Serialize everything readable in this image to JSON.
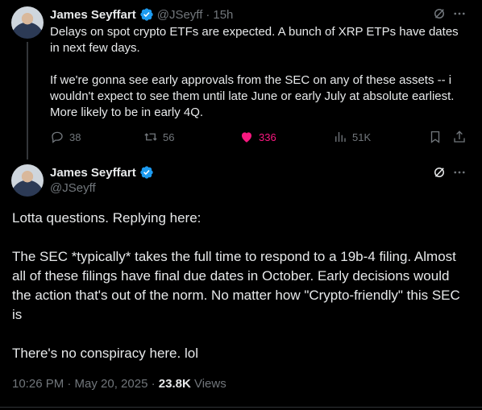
{
  "parent_tweet": {
    "author_name": "James Seyffart",
    "handle": "@JSeyff",
    "separator": "·",
    "time_ago": "15h",
    "text": "Delays on spot crypto ETFs are expected. A bunch of XRP ETPs have dates in next few days.\n\nIf we're gonna see early approvals from the SEC on any of these assets -- i wouldn't expect to see them until late June or early July at absolute earliest. More likely to be in early 4Q.",
    "replies": "38",
    "reposts": "56",
    "likes": "336",
    "views": "51K",
    "like_color": "#f91880"
  },
  "main_tweet": {
    "author_name": "James Seyffart",
    "handle": "@JSeyff",
    "text": "Lotta questions. Replying here:\n\nThe SEC *typically* takes the full time to respond to a 19b-4 filing. Almost all of these filings have final due dates in October. Early decisions would the action that's out of the norm. No matter how \"Crypto-friendly\" this SEC is\n\nThere's no conspiracy here. lol",
    "timestamp": "10:26 PM · May 20, 2025",
    "separator": "·",
    "views_count": "23.8K",
    "views_label": "Views"
  },
  "colors": {
    "background": "#000000",
    "text": "#e7e9ea",
    "muted": "#71767b",
    "verified": "#1d9bf0"
  }
}
